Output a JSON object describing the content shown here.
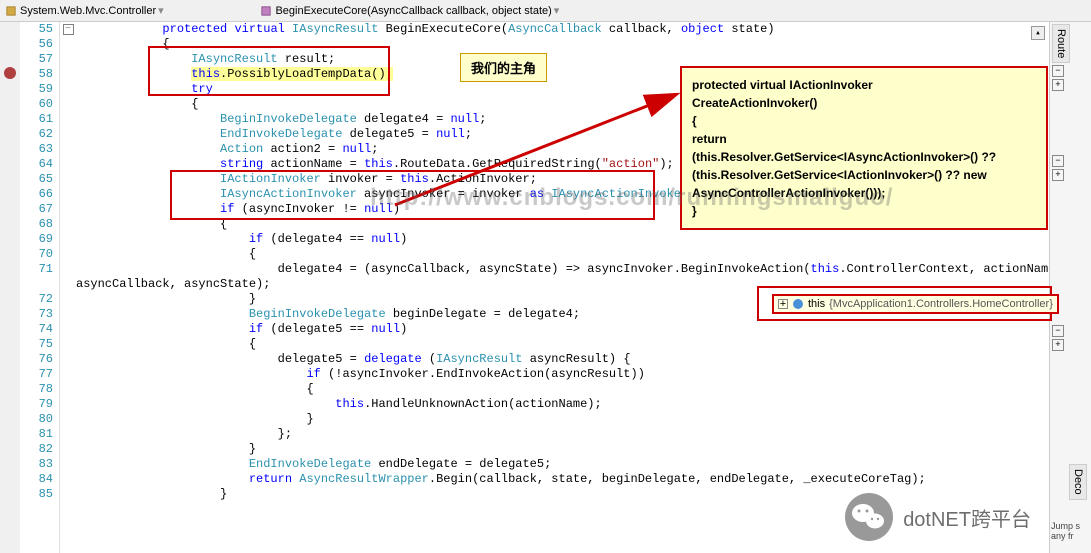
{
  "breadcrumb": {
    "left_icon": "class-icon",
    "left_text": "System.Web.Mvc.Controller",
    "right_icon": "method-icon",
    "right_text": "BeginExecuteCore(AsyncCallback callback, object state)"
  },
  "line_numbers": [
    "55",
    "56",
    "57",
    "58",
    "59",
    "60",
    "61",
    "62",
    "63",
    "64",
    "65",
    "66",
    "67",
    "68",
    "69",
    "70",
    "71",
    "",
    "72",
    "73",
    "74",
    "75",
    "76",
    "77",
    "78",
    "79",
    "80",
    "81",
    "82",
    "83",
    "84",
    "85"
  ],
  "breakpoint_line": 58,
  "fold_minus_at": 55,
  "code": {
    "l55": {
      "indent": "            ",
      "tokens": [
        {
          "t": "protected ",
          "c": "kw"
        },
        {
          "t": "virtual ",
          "c": "kw"
        },
        {
          "t": "IAsyncResult",
          "c": "type"
        },
        {
          "t": " BeginExecuteCore(",
          "c": ""
        },
        {
          "t": "AsyncCallback",
          "c": "type"
        },
        {
          "t": " callback, ",
          "c": ""
        },
        {
          "t": "object",
          "c": "kw"
        },
        {
          "t": " state)",
          "c": ""
        }
      ]
    },
    "l56": {
      "indent": "            ",
      "tokens": [
        {
          "t": "{",
          "c": ""
        }
      ]
    },
    "l57": {
      "indent": "                ",
      "tokens": [
        {
          "t": "IAsyncResult",
          "c": "type"
        },
        {
          "t": " result;",
          "c": ""
        }
      ]
    },
    "l58": {
      "indent": "                ",
      "tokens": [
        {
          "t": "this",
          "c": "kw"
        },
        {
          "t": ".PossiblyLoadTempData();",
          "c": ""
        }
      ],
      "hl": true
    },
    "l59": {
      "indent": "                ",
      "tokens": [
        {
          "t": "try",
          "c": "kw"
        }
      ]
    },
    "l60": {
      "indent": "                ",
      "tokens": [
        {
          "t": "{",
          "c": ""
        }
      ]
    },
    "l61": {
      "indent": "                    ",
      "tokens": [
        {
          "t": "BeginInvokeDelegate",
          "c": "type"
        },
        {
          "t": " delegate4 = ",
          "c": ""
        },
        {
          "t": "null",
          "c": "kw"
        },
        {
          "t": ";",
          "c": ""
        }
      ]
    },
    "l62": {
      "indent": "                    ",
      "tokens": [
        {
          "t": "EndInvokeDelegate",
          "c": "type"
        },
        {
          "t": " delegate5 = ",
          "c": ""
        },
        {
          "t": "null",
          "c": "kw"
        },
        {
          "t": ";",
          "c": ""
        }
      ]
    },
    "l63": {
      "indent": "                    ",
      "tokens": [
        {
          "t": "Action",
          "c": "type"
        },
        {
          "t": " action2 = ",
          "c": ""
        },
        {
          "t": "null",
          "c": "kw"
        },
        {
          "t": ";",
          "c": ""
        }
      ]
    },
    "l64": {
      "indent": "                    ",
      "tokens": [
        {
          "t": "string",
          "c": "kw"
        },
        {
          "t": " actionName = ",
          "c": ""
        },
        {
          "t": "this",
          "c": "kw"
        },
        {
          "t": ".RouteData.GetRequiredString(",
          "c": ""
        },
        {
          "t": "\"action\"",
          "c": "str"
        },
        {
          "t": ");",
          "c": ""
        }
      ]
    },
    "l65": {
      "indent": "                    ",
      "tokens": [
        {
          "t": "IActionInvoker",
          "c": "type"
        },
        {
          "t": " invoker = ",
          "c": ""
        },
        {
          "t": "this",
          "c": "kw"
        },
        {
          "t": ".ActionInvoker;",
          "c": ""
        }
      ]
    },
    "l66": {
      "indent": "                    ",
      "tokens": [
        {
          "t": "IAsyncActionInvoker",
          "c": "type"
        },
        {
          "t": " asyncInvoker = invoker ",
          "c": ""
        },
        {
          "t": "as",
          "c": "kw"
        },
        {
          "t": " ",
          "c": ""
        },
        {
          "t": "IAsyncActionInvoker",
          "c": "type"
        },
        {
          "t": ";",
          "c": ""
        }
      ]
    },
    "l67": {
      "indent": "                    ",
      "tokens": [
        {
          "t": "if",
          "c": "kw"
        },
        {
          "t": " (asyncInvoker != ",
          "c": ""
        },
        {
          "t": "null",
          "c": "kw"
        },
        {
          "t": ")",
          "c": ""
        }
      ]
    },
    "l68": {
      "indent": "                    ",
      "tokens": [
        {
          "t": "{",
          "c": ""
        }
      ]
    },
    "l69": {
      "indent": "                        ",
      "tokens": [
        {
          "t": "if",
          "c": "kw"
        },
        {
          "t": " (delegate4 == ",
          "c": ""
        },
        {
          "t": "null",
          "c": "kw"
        },
        {
          "t": ")",
          "c": ""
        }
      ]
    },
    "l70": {
      "indent": "                        ",
      "tokens": [
        {
          "t": "{",
          "c": ""
        }
      ]
    },
    "l71": {
      "indent": "                            ",
      "tokens": [
        {
          "t": "delegate4 = (asyncCallback, asyncState) => asyncInvoker.BeginInvokeAction(",
          "c": ""
        },
        {
          "t": "this",
          "c": "kw"
        },
        {
          "t": ".ControllerContext, actionName, ",
          "c": ""
        }
      ]
    },
    "l71b": {
      "indent": "",
      "tokens": [
        {
          "t": "asyncCallback, asyncState);",
          "c": ""
        }
      ]
    },
    "l72": {
      "indent": "                        ",
      "tokens": [
        {
          "t": "}",
          "c": ""
        }
      ]
    },
    "l73": {
      "indent": "                        ",
      "tokens": [
        {
          "t": "BeginInvokeDelegate",
          "c": "type"
        },
        {
          "t": " beginDelegate = delegate4;",
          "c": ""
        }
      ]
    },
    "l74": {
      "indent": "                        ",
      "tokens": [
        {
          "t": "if",
          "c": "kw"
        },
        {
          "t": " (delegate5 == ",
          "c": ""
        },
        {
          "t": "null",
          "c": "kw"
        },
        {
          "t": ")",
          "c": ""
        }
      ]
    },
    "l75": {
      "indent": "                        ",
      "tokens": [
        {
          "t": "{",
          "c": ""
        }
      ]
    },
    "l76": {
      "indent": "                            ",
      "tokens": [
        {
          "t": "delegate5 = ",
          "c": ""
        },
        {
          "t": "delegate",
          "c": "kw"
        },
        {
          "t": " (",
          "c": ""
        },
        {
          "t": "IAsyncResult",
          "c": "type"
        },
        {
          "t": " asyncResult) {",
          "c": ""
        }
      ]
    },
    "l77": {
      "indent": "                                ",
      "tokens": [
        {
          "t": "if",
          "c": "kw"
        },
        {
          "t": " (!asyncInvoker.EndInvokeAction(asyncResult))",
          "c": ""
        }
      ]
    },
    "l78": {
      "indent": "                                ",
      "tokens": [
        {
          "t": "{",
          "c": ""
        }
      ]
    },
    "l79": {
      "indent": "                                    ",
      "tokens": [
        {
          "t": "this",
          "c": "kw"
        },
        {
          "t": ".HandleUnknownAction(actionName);",
          "c": ""
        }
      ]
    },
    "l80": {
      "indent": "                                ",
      "tokens": [
        {
          "t": "}",
          "c": ""
        }
      ]
    },
    "l81": {
      "indent": "                            ",
      "tokens": [
        {
          "t": "};",
          "c": ""
        }
      ]
    },
    "l82": {
      "indent": "                        ",
      "tokens": [
        {
          "t": "}",
          "c": ""
        }
      ]
    },
    "l83": {
      "indent": "                        ",
      "tokens": [
        {
          "t": "EndInvokeDelegate",
          "c": "type"
        },
        {
          "t": " endDelegate = delegate5;",
          "c": ""
        }
      ]
    },
    "l84": {
      "indent": "                        ",
      "tokens": [
        {
          "t": "return",
          "c": "kw"
        },
        {
          "t": " ",
          "c": ""
        },
        {
          "t": "AsyncResultWrapper",
          "c": "type"
        },
        {
          "t": ".Begin(callback, state, beginDelegate, endDelegate, _executeCoreTag);",
          "c": ""
        }
      ]
    },
    "l85": {
      "indent": "                    ",
      "tokens": [
        {
          "t": "}",
          "c": ""
        }
      ]
    }
  },
  "callout_label": "我们的主角",
  "tooltip": {
    "line1": "protected virtual IActionInvoker",
    "line2": "CreateActionInvoker()",
    "line3": "         {",
    "line4": "             return",
    "line5": "(this.Resolver.GetService<IAsyncActionInvoker>() ??",
    "line6": "(this.Resolver.GetService<IActionInvoker>() ?? new",
    "line7": "AsyncControllerActionInvoker()));",
    "line8": "         }"
  },
  "debug_tip": {
    "var": "this",
    "value": "{MvcApplication1.Controllers.HomeController}"
  },
  "watermark_text": "http://www.cnblogs.com/runningsmallguo/",
  "wechat_label": "dotNET跨平台",
  "side": {
    "tab1": "Route",
    "tab2": "Deco",
    "footer1": "Jump s",
    "footer2": "any fr"
  }
}
